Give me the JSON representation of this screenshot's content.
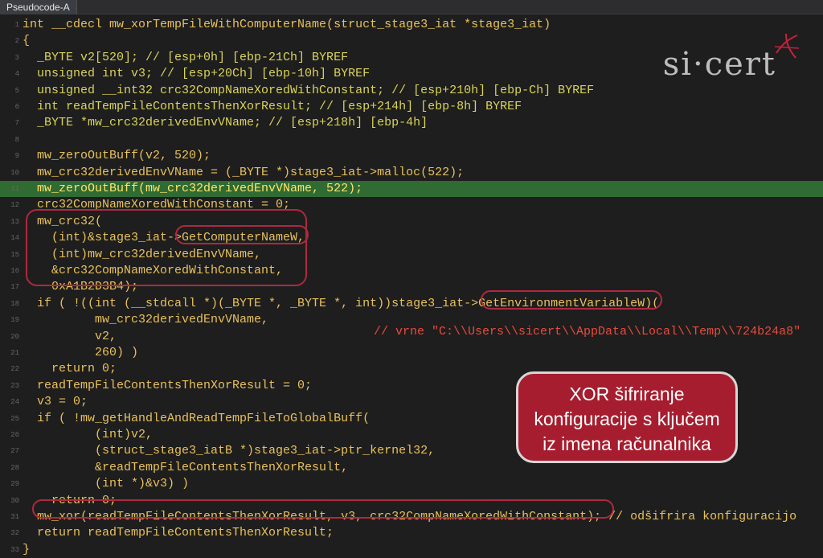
{
  "window": {
    "tab_title": "Pseudocode-A"
  },
  "branding": {
    "logo_text": "si·cert"
  },
  "callout": {
    "lines": [
      "XOR šifriranje",
      "konfiguracije s ključem",
      "iz imena računalnika"
    ]
  },
  "code": {
    "lines": [
      {
        "n": "1",
        "t": "int __cdecl mw_xorTempFileWithComputerName(struct_stage3_iat *stage3_iat)"
      },
      {
        "n": "2",
        "t": "{"
      },
      {
        "n": "3",
        "t": "  _BYTE v2[520]; // [esp+0h] [ebp-21Ch] BYREF"
      },
      {
        "n": "4",
        "t": "  unsigned int v3; // [esp+20Ch] [ebp-10h] BYREF"
      },
      {
        "n": "5",
        "t": "  unsigned __int32 crc32CompNameXoredWithConstant; // [esp+210h] [ebp-Ch] BYREF"
      },
      {
        "n": "6",
        "t": "  int readTempFileContentsThenXorResult; // [esp+214h] [ebp-8h] BYREF"
      },
      {
        "n": "7",
        "t": "  _BYTE *mw_crc32derivedEnvVName; // [esp+218h] [ebp-4h]"
      },
      {
        "n": "8",
        "t": ""
      },
      {
        "n": "9",
        "t": "  mw_zeroOutBuff(v2, 520);"
      },
      {
        "n": "10",
        "t": "  mw_crc32derivedEnvVName = (_BYTE *)stage3_iat->malloc(522);"
      },
      {
        "n": "11",
        "t": "  mw_zeroOutBuff(mw_crc32derivedEnvVName, 522);"
      },
      {
        "n": "12",
        "t": "  crc32CompNameXoredWithConstant = 0;"
      },
      {
        "n": "13",
        "t": "  mw_crc32("
      },
      {
        "n": "14",
        "t": "    (int)&stage3_iat->GetComputerNameW,"
      },
      {
        "n": "15",
        "t": "    (int)mw_crc32derivedEnvVName,"
      },
      {
        "n": "16",
        "t": "    &crc32CompNameXoredWithConstant,"
      },
      {
        "n": "17",
        "t": "    0xA1B2D3B4);"
      },
      {
        "n": "18",
        "t": "  if ( !((int (__stdcall *)(_BYTE *, _BYTE *, int))stage3_iat->GetEnvironmentVariableW)("
      },
      {
        "n": "19",
        "t": "          mw_crc32derivedEnvVName,"
      },
      {
        "n": "20",
        "t": "          v2,"
      },
      {
        "n": "21",
        "t": "          260) )"
      },
      {
        "n": "22",
        "t": "    return 0;"
      },
      {
        "n": "23",
        "t": "  readTempFileContentsThenXorResult = 0;"
      },
      {
        "n": "24",
        "t": "  v3 = 0;"
      },
      {
        "n": "25",
        "t": "  if ( !mw_getHandleAndReadTempFileToGlobalBuff("
      },
      {
        "n": "26",
        "t": "          (int)v2,"
      },
      {
        "n": "27",
        "t": "          (struct_stage3_iatB *)stage3_iat->ptr_kernel32,"
      },
      {
        "n": "28",
        "t": "          &readTempFileContentsThenXorResult,"
      },
      {
        "n": "29",
        "t": "          (int *)&v3) )"
      },
      {
        "n": "30",
        "t": "    return 0;"
      },
      {
        "n": "31",
        "t": "  mw_xor(readTempFileContentsThenXorResult, v3, crc32CompNameXoredWithConstant); // odšifrira konfiguracijo"
      },
      {
        "n": "32",
        "t": "  return readTempFileContentsThenXorResult;"
      },
      {
        "n": "33",
        "t": "}"
      }
    ],
    "inline_comment": "// vrne \"C:\\\\Users\\\\sicert\\\\AppData\\\\Local\\\\Temp\\\\724b24a8\""
  },
  "colors": {
    "accent": "#a51d2e",
    "highlight_row": "#2f6b32"
  }
}
